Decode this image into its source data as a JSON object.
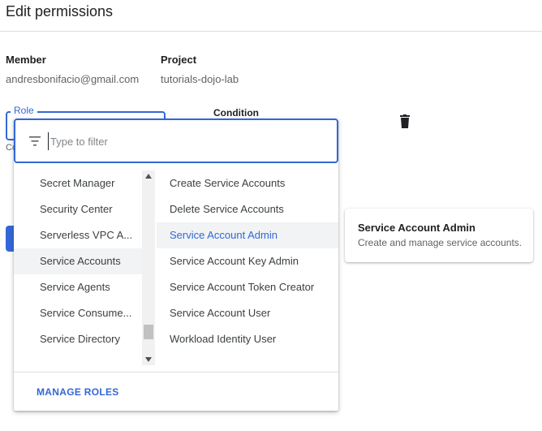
{
  "header": {
    "title": "Edit permissions"
  },
  "member": {
    "label": "Member",
    "value": "andresbonifacio@gmail.com"
  },
  "project": {
    "label": "Project",
    "value": "tutorials-dojo-lab"
  },
  "role": {
    "legend": "Role",
    "helper_fragment": "Co"
  },
  "condition": {
    "label": "Condition"
  },
  "filter": {
    "placeholder": "Type to filter",
    "value": ""
  },
  "services": {
    "items": [
      {
        "label": "Secret Manager"
      },
      {
        "label": "Security Center"
      },
      {
        "label": "Serverless VPC A..."
      },
      {
        "label": "Service Accounts",
        "selected": true
      },
      {
        "label": "Service Agents"
      },
      {
        "label": "Service Consume..."
      },
      {
        "label": "Service Directory"
      }
    ]
  },
  "roles": {
    "items": [
      {
        "label": "Create Service Accounts"
      },
      {
        "label": "Delete Service Accounts"
      },
      {
        "label": "Service Account Admin",
        "highlighted": true
      },
      {
        "label": "Service Account Key Admin"
      },
      {
        "label": "Service Account Token Creator"
      },
      {
        "label": "Service Account User"
      },
      {
        "label": "Workload Identity User"
      }
    ]
  },
  "footer": {
    "manage_roles": "MANAGE ROLES"
  },
  "info_card": {
    "title": "Service Account Admin",
    "description": "Create and manage service accounts."
  },
  "colors": {
    "accent": "#3367d6",
    "highlight_bg": "#f1f3f4",
    "text_primary": "#202124",
    "text_secondary": "#5f6368"
  },
  "icons": {
    "filter": "filter-list-icon",
    "delete": "trash-icon",
    "scroll_up": "arrow-up-icon",
    "scroll_down": "arrow-down-icon"
  }
}
